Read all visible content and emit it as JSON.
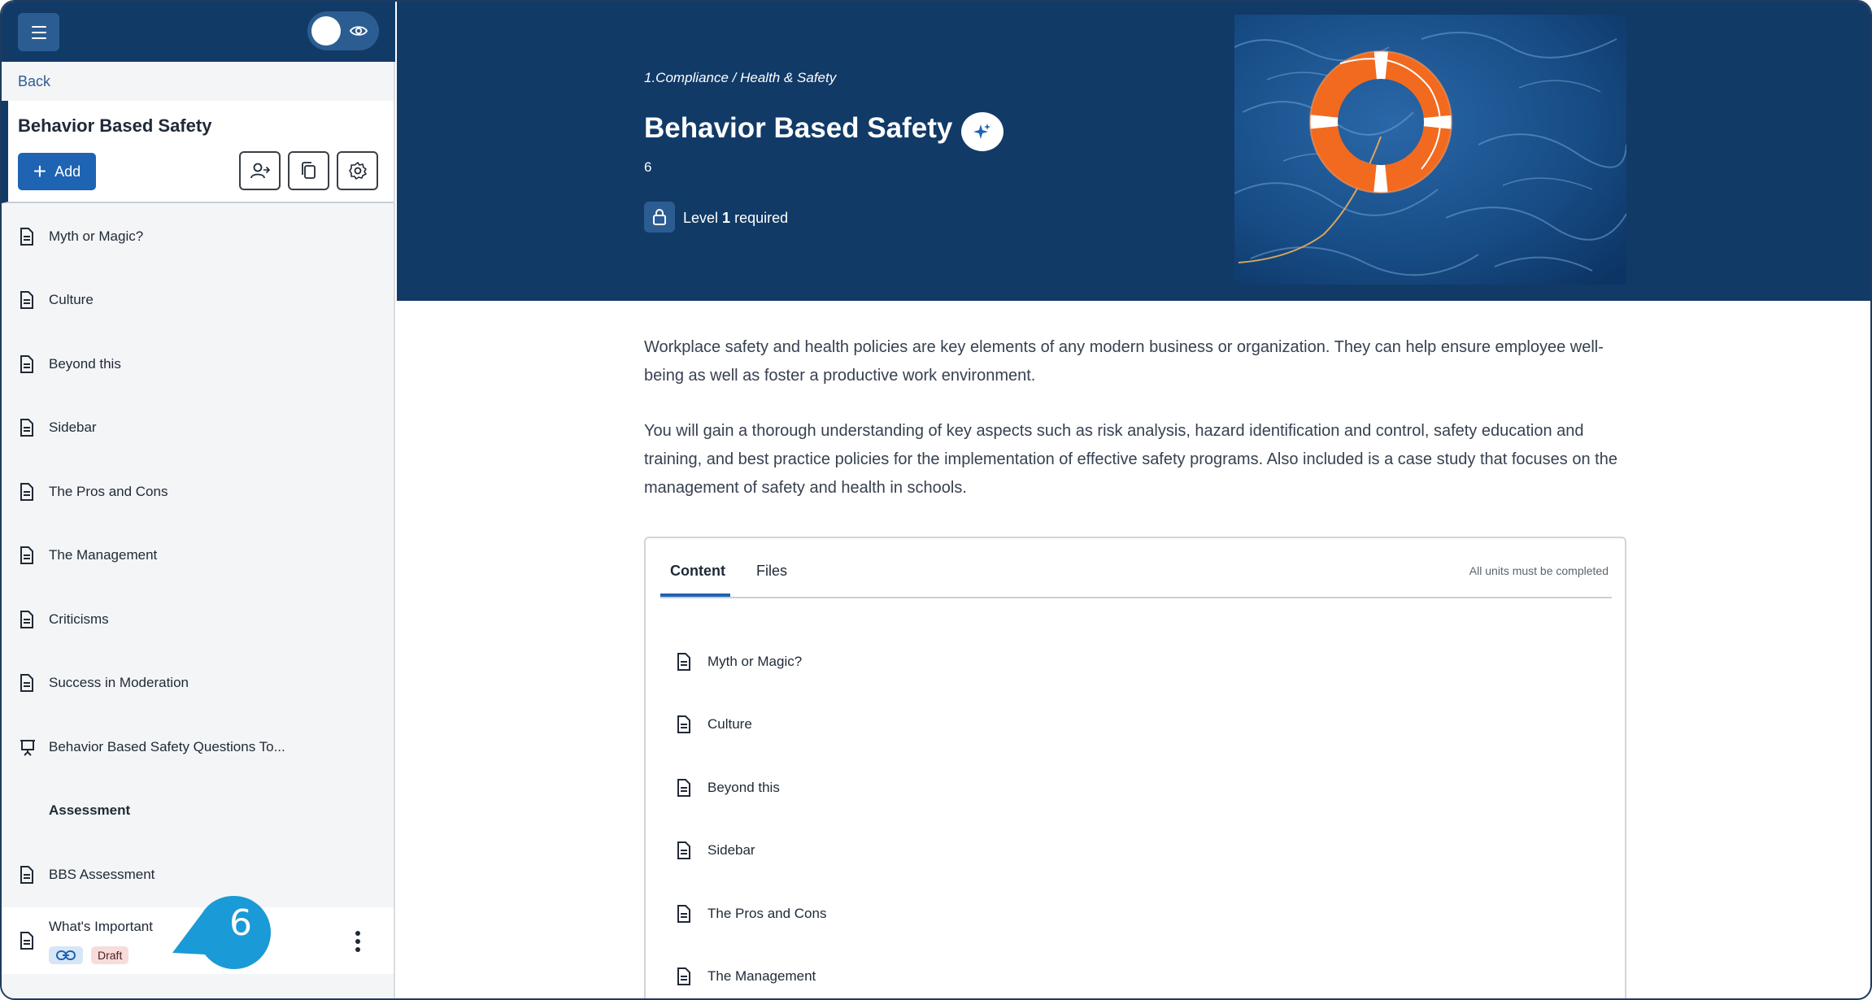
{
  "sidebar": {
    "back_label": "Back",
    "title": "Behavior Based Safety",
    "add_label": "Add",
    "items": [
      {
        "label": "Myth or Magic?",
        "icon": "document-icon"
      },
      {
        "label": "Culture",
        "icon": "document-icon"
      },
      {
        "label": "Beyond this",
        "icon": "document-icon"
      },
      {
        "label": "Sidebar",
        "icon": "document-icon"
      },
      {
        "label": "The Pros and Cons",
        "icon": "document-icon"
      },
      {
        "label": "The Management",
        "icon": "document-icon"
      },
      {
        "label": "Criticisms",
        "icon": "document-icon"
      },
      {
        "label": "Success in Moderation",
        "icon": "document-icon"
      },
      {
        "label": "Behavior Based Safety Questions To...",
        "icon": "presentation-icon"
      },
      {
        "label": "Assessment",
        "icon": ""
      },
      {
        "label": "BBS Assessment",
        "icon": "document-icon"
      }
    ],
    "active_item": {
      "label": "What's Important",
      "badge": "Draft",
      "icon": "document-icon"
    },
    "callout_number": "6"
  },
  "hero": {
    "breadcrumb": "1.Compliance / Health & Safety",
    "title": "Behavior Based Safety",
    "count": "6",
    "level_prefix": "Level",
    "level_number": "1",
    "level_suffix": "required"
  },
  "description": {
    "para1": "Workplace safety and health policies are key elements of any modern business or organization. They can help ensure employee well-being as well as foster a productive work environment.",
    "para2": "You will gain a thorough understanding of key aspects such as risk analysis, hazard identification and control, safety education and training, and best practice policies for the implementation of effective safety programs. Also included is a case study that focuses on the management of safety and health in schools."
  },
  "content_card": {
    "tabs": [
      "Content",
      "Files"
    ],
    "note": "All units must be completed",
    "items": [
      "Myth or Magic?",
      "Culture",
      "Beyond this",
      "Sidebar",
      "The Pros and Cons",
      "The Management"
    ]
  },
  "colors": {
    "navy": "#113a67",
    "accent_blue": "#1f63b3",
    "callout": "#1a9ad6"
  }
}
